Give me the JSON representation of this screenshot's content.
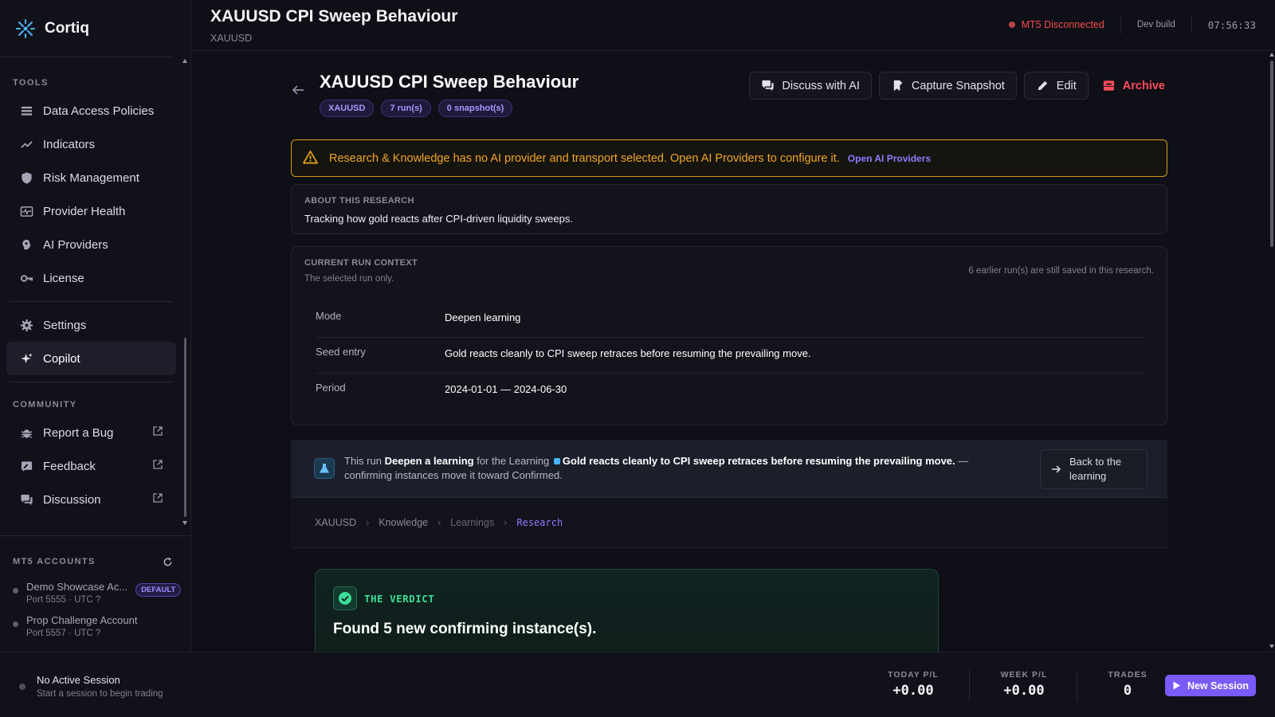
{
  "app": {
    "name": "Cortiq"
  },
  "sidebar": {
    "tools_label": "TOOLS",
    "tools": [
      {
        "label": "Data Access Policies",
        "icon": "table-icon"
      },
      {
        "label": "Indicators",
        "icon": "trend-icon"
      },
      {
        "label": "Risk Management",
        "icon": "shield-icon"
      },
      {
        "label": "Provider Health",
        "icon": "heartbeat-icon"
      },
      {
        "label": "AI Providers",
        "icon": "brain-icon"
      },
      {
        "label": "License",
        "icon": "key-icon"
      }
    ],
    "settings_label": "Settings",
    "copilot_label": "Copilot",
    "community_label": "COMMUNITY",
    "community": [
      {
        "label": "Report a Bug",
        "icon": "bug-icon"
      },
      {
        "label": "Feedback",
        "icon": "feedback-icon"
      },
      {
        "label": "Discussion",
        "icon": "chat-icon"
      }
    ],
    "accounts_label": "MT5 ACCOUNTS",
    "accounts": [
      {
        "name": "Demo Showcase Ac...",
        "meta": "Port 5555 · UTC ?",
        "badge": "DEFAULT"
      },
      {
        "name": "Prop Challenge Account",
        "meta": "Port 5557 · UTC ?"
      }
    ]
  },
  "header": {
    "title": "XAUUSD CPI Sweep Behaviour",
    "subtitle": "XAUUSD",
    "mt5_status": "MT5 Disconnected",
    "build": "Dev build",
    "clock": "07:56:33"
  },
  "research": {
    "title": "XAUUSD CPI Sweep Behaviour",
    "tags": [
      "XAUUSD",
      "7 run(s)",
      "0 snapshot(s)"
    ],
    "actions": {
      "discuss": "Discuss with AI",
      "capture": "Capture Snapshot",
      "edit": "Edit",
      "archive": "Archive"
    },
    "alert": {
      "text": "Research & Knowledge has no AI provider and transport selected. Open AI Providers to configure it.",
      "link": "Open AI Providers"
    },
    "about": {
      "label": "ABOUT THIS RESEARCH",
      "text": "Tracking how gold reacts after CPI-driven liquidity sweeps."
    },
    "run_context": {
      "label": "CURRENT RUN CONTEXT",
      "sub": "The selected run only.",
      "note": "6 earlier run(s) are still saved in this research.",
      "rows": [
        {
          "key": "Mode",
          "value": "Deepen learning"
        },
        {
          "key": "Seed entry",
          "value": "Gold reacts cleanly to CPI sweep retraces before resuming the prevailing move."
        },
        {
          "key": "Period",
          "value": "2024-01-01 — 2024-06-30"
        }
      ]
    },
    "learning_bar": {
      "prefix": "This run",
      "action": "Deepen a learning",
      "middle": "for the Learning",
      "learning": "Gold reacts cleanly to CPI sweep retraces before resuming the prevailing move.",
      "suffix": "— confirming instances move it toward Confirmed.",
      "back": "Back to the learning"
    },
    "breadcrumbs": [
      "XAUUSD",
      "Knowledge",
      "Learnings",
      "Research"
    ],
    "verdict": {
      "label": "THE VERDICT",
      "title": "Found 5 new confirming instance(s)."
    }
  },
  "footer": {
    "session_title": "No Active Session",
    "session_sub": "Start a session to begin trading",
    "today_label": "TODAY P/L",
    "today_value": "+0.00",
    "week_label": "WEEK P/L",
    "week_value": "+0.00",
    "trades_label": "TRADES",
    "trades_value": "0",
    "new_session": "New Session"
  },
  "colors": {
    "accent": "#7a5af8",
    "danger": "#f24d4d",
    "warning": "#e8a520",
    "success": "#3ddc97"
  }
}
